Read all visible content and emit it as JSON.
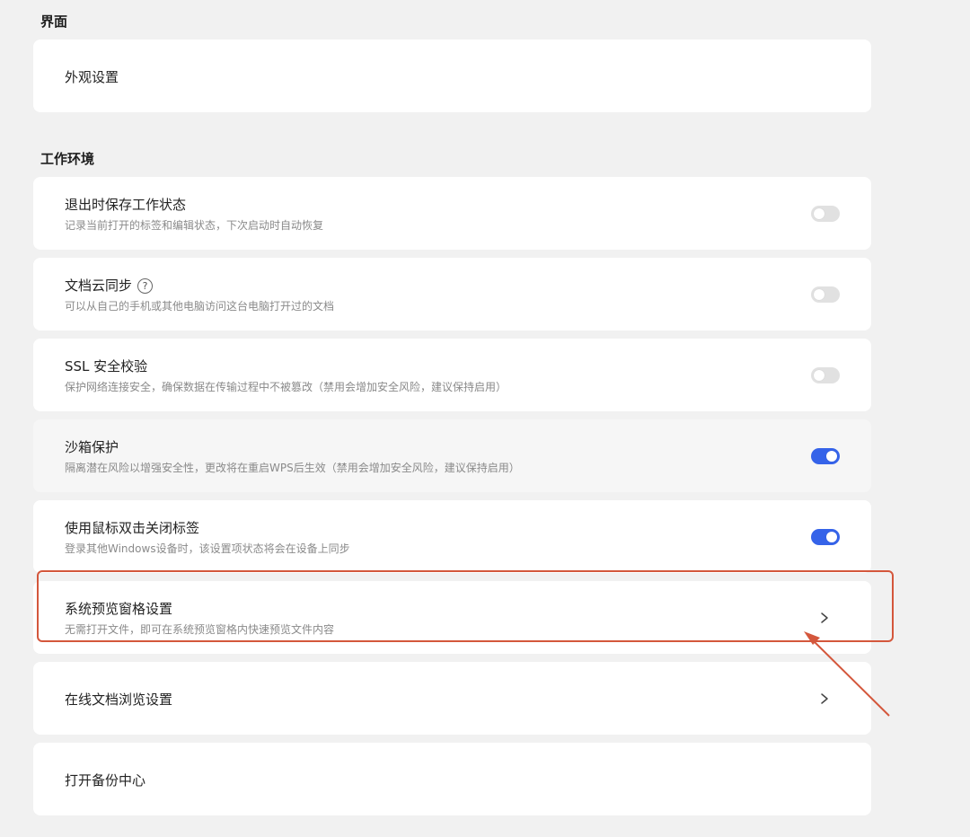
{
  "sections": {
    "interface": {
      "title": "界面",
      "items": [
        {
          "title": "外观设置"
        }
      ]
    },
    "workspace": {
      "title": "工作环境",
      "items": [
        {
          "title": "退出时保存工作状态",
          "desc": "记录当前打开的标签和编辑状态，下次启动时自动恢复",
          "control": "toggle",
          "state": "off"
        },
        {
          "title": "文档云同步",
          "help_icon": "?",
          "desc": "可以从自己的手机或其他电脑访问这台电脑打开过的文档",
          "control": "toggle",
          "state": "off"
        },
        {
          "title": "SSL 安全校验",
          "desc": "保护网络连接安全，确保数据在传输过程中不被篡改（禁用会增加安全风险，建议保持启用）",
          "control": "toggle",
          "state": "off"
        },
        {
          "title": "沙箱保护",
          "desc": "隔离潜在风险以增强安全性，更改将在重启WPS后生效（禁用会增加安全风险，建议保持启用）",
          "control": "toggle",
          "state": "on"
        },
        {
          "title": "使用鼠标双击关闭标签",
          "desc": "登录其他Windows设备时，该设置项状态将会在设备上同步",
          "control": "toggle",
          "state": "on"
        },
        {
          "title": "系统预览窗格设置",
          "desc": "无需打开文件，即可在系统预览窗格内快速预览文件内容",
          "control": "chevron"
        },
        {
          "title": "在线文档浏览设置",
          "control": "chevron"
        },
        {
          "title": "打开备份中心"
        }
      ]
    }
  },
  "colors": {
    "background": "#f1f1f1",
    "card": "#ffffff",
    "toggle_on": "#3563e9",
    "toggle_off": "#e1e1e1",
    "annotation": "#d4573c"
  },
  "icons": {
    "help": "question-circle-icon",
    "chevron": "chevron-right-icon"
  }
}
